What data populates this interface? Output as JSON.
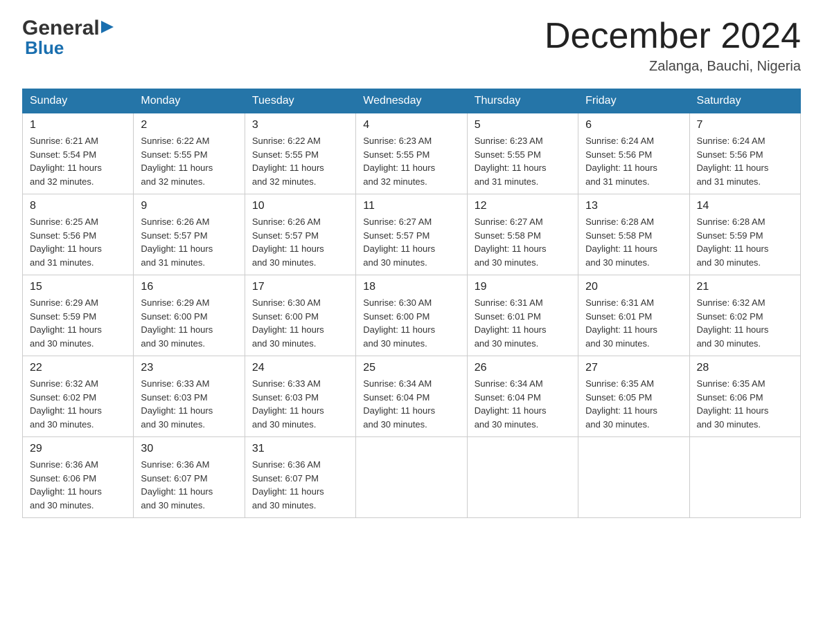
{
  "header": {
    "logo_general": "General",
    "logo_blue": "Blue",
    "month_title": "December 2024",
    "location": "Zalanga, Bauchi, Nigeria"
  },
  "days_of_week": [
    "Sunday",
    "Monday",
    "Tuesday",
    "Wednesday",
    "Thursday",
    "Friday",
    "Saturday"
  ],
  "weeks": [
    [
      {
        "day": "1",
        "sunrise": "6:21 AM",
        "sunset": "5:54 PM",
        "daylight": "11 hours and 32 minutes."
      },
      {
        "day": "2",
        "sunrise": "6:22 AM",
        "sunset": "5:55 PM",
        "daylight": "11 hours and 32 minutes."
      },
      {
        "day": "3",
        "sunrise": "6:22 AM",
        "sunset": "5:55 PM",
        "daylight": "11 hours and 32 minutes."
      },
      {
        "day": "4",
        "sunrise": "6:23 AM",
        "sunset": "5:55 PM",
        "daylight": "11 hours and 32 minutes."
      },
      {
        "day": "5",
        "sunrise": "6:23 AM",
        "sunset": "5:55 PM",
        "daylight": "11 hours and 31 minutes."
      },
      {
        "day": "6",
        "sunrise": "6:24 AM",
        "sunset": "5:56 PM",
        "daylight": "11 hours and 31 minutes."
      },
      {
        "day": "7",
        "sunrise": "6:24 AM",
        "sunset": "5:56 PM",
        "daylight": "11 hours and 31 minutes."
      }
    ],
    [
      {
        "day": "8",
        "sunrise": "6:25 AM",
        "sunset": "5:56 PM",
        "daylight": "11 hours and 31 minutes."
      },
      {
        "day": "9",
        "sunrise": "6:26 AM",
        "sunset": "5:57 PM",
        "daylight": "11 hours and 31 minutes."
      },
      {
        "day": "10",
        "sunrise": "6:26 AM",
        "sunset": "5:57 PM",
        "daylight": "11 hours and 30 minutes."
      },
      {
        "day": "11",
        "sunrise": "6:27 AM",
        "sunset": "5:57 PM",
        "daylight": "11 hours and 30 minutes."
      },
      {
        "day": "12",
        "sunrise": "6:27 AM",
        "sunset": "5:58 PM",
        "daylight": "11 hours and 30 minutes."
      },
      {
        "day": "13",
        "sunrise": "6:28 AM",
        "sunset": "5:58 PM",
        "daylight": "11 hours and 30 minutes."
      },
      {
        "day": "14",
        "sunrise": "6:28 AM",
        "sunset": "5:59 PM",
        "daylight": "11 hours and 30 minutes."
      }
    ],
    [
      {
        "day": "15",
        "sunrise": "6:29 AM",
        "sunset": "5:59 PM",
        "daylight": "11 hours and 30 minutes."
      },
      {
        "day": "16",
        "sunrise": "6:29 AM",
        "sunset": "6:00 PM",
        "daylight": "11 hours and 30 minutes."
      },
      {
        "day": "17",
        "sunrise": "6:30 AM",
        "sunset": "6:00 PM",
        "daylight": "11 hours and 30 minutes."
      },
      {
        "day": "18",
        "sunrise": "6:30 AM",
        "sunset": "6:00 PM",
        "daylight": "11 hours and 30 minutes."
      },
      {
        "day": "19",
        "sunrise": "6:31 AM",
        "sunset": "6:01 PM",
        "daylight": "11 hours and 30 minutes."
      },
      {
        "day": "20",
        "sunrise": "6:31 AM",
        "sunset": "6:01 PM",
        "daylight": "11 hours and 30 minutes."
      },
      {
        "day": "21",
        "sunrise": "6:32 AM",
        "sunset": "6:02 PM",
        "daylight": "11 hours and 30 minutes."
      }
    ],
    [
      {
        "day": "22",
        "sunrise": "6:32 AM",
        "sunset": "6:02 PM",
        "daylight": "11 hours and 30 minutes."
      },
      {
        "day": "23",
        "sunrise": "6:33 AM",
        "sunset": "6:03 PM",
        "daylight": "11 hours and 30 minutes."
      },
      {
        "day": "24",
        "sunrise": "6:33 AM",
        "sunset": "6:03 PM",
        "daylight": "11 hours and 30 minutes."
      },
      {
        "day": "25",
        "sunrise": "6:34 AM",
        "sunset": "6:04 PM",
        "daylight": "11 hours and 30 minutes."
      },
      {
        "day": "26",
        "sunrise": "6:34 AM",
        "sunset": "6:04 PM",
        "daylight": "11 hours and 30 minutes."
      },
      {
        "day": "27",
        "sunrise": "6:35 AM",
        "sunset": "6:05 PM",
        "daylight": "11 hours and 30 minutes."
      },
      {
        "day": "28",
        "sunrise": "6:35 AM",
        "sunset": "6:06 PM",
        "daylight": "11 hours and 30 minutes."
      }
    ],
    [
      {
        "day": "29",
        "sunrise": "6:36 AM",
        "sunset": "6:06 PM",
        "daylight": "11 hours and 30 minutes."
      },
      {
        "day": "30",
        "sunrise": "6:36 AM",
        "sunset": "6:07 PM",
        "daylight": "11 hours and 30 minutes."
      },
      {
        "day": "31",
        "sunrise": "6:36 AM",
        "sunset": "6:07 PM",
        "daylight": "11 hours and 30 minutes."
      },
      null,
      null,
      null,
      null
    ]
  ],
  "labels": {
    "sunrise": "Sunrise:",
    "sunset": "Sunset:",
    "daylight": "Daylight:"
  }
}
